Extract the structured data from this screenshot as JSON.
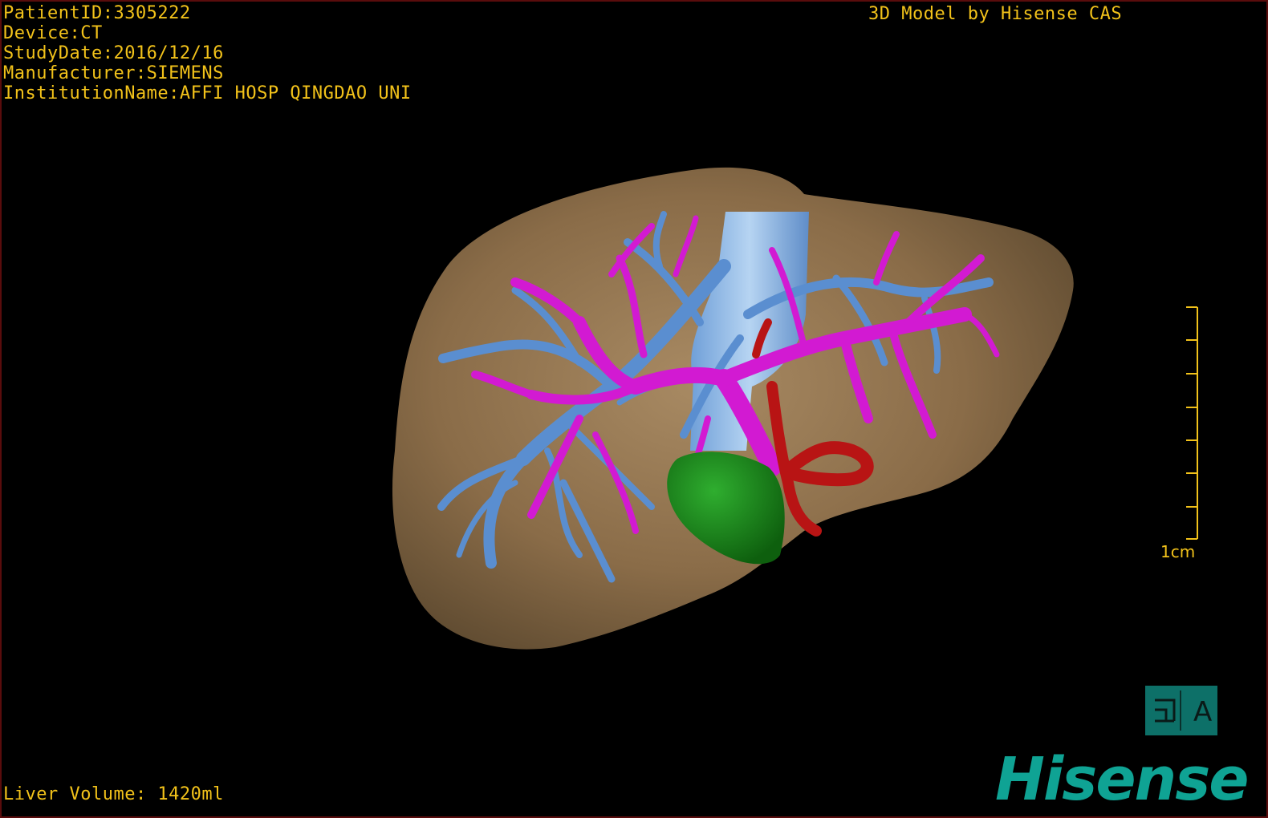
{
  "header": {
    "patient_id": "PatientID:3305222",
    "device": "Device:CT",
    "study_date": "StudyDate:2016/12/16",
    "manufacturer": "Manufacturer:SIEMENS",
    "institution": "InstitutionName:AFFI HOSP QINGDAO UNI",
    "credit": "3D Model by Hisense CAS"
  },
  "footer": {
    "liver_volume": "Liver Volume: 1420ml"
  },
  "scale": {
    "label": "1cm"
  },
  "view_button": {
    "left_glyph": "⊐",
    "right_glyph": "A",
    "icon": "view-orientation-icon"
  },
  "brand": {
    "name": "Hisense"
  },
  "colors": {
    "overlay_text": "#f2c21a",
    "liver": "#8a6a45",
    "portal_vein": "#d21ad2",
    "hepatic_vein": "#5a8ed0",
    "ivc": "#8fb8e8",
    "artery": "#b81414",
    "tumor": "#1b8a1b",
    "brand": "#0fa394"
  }
}
